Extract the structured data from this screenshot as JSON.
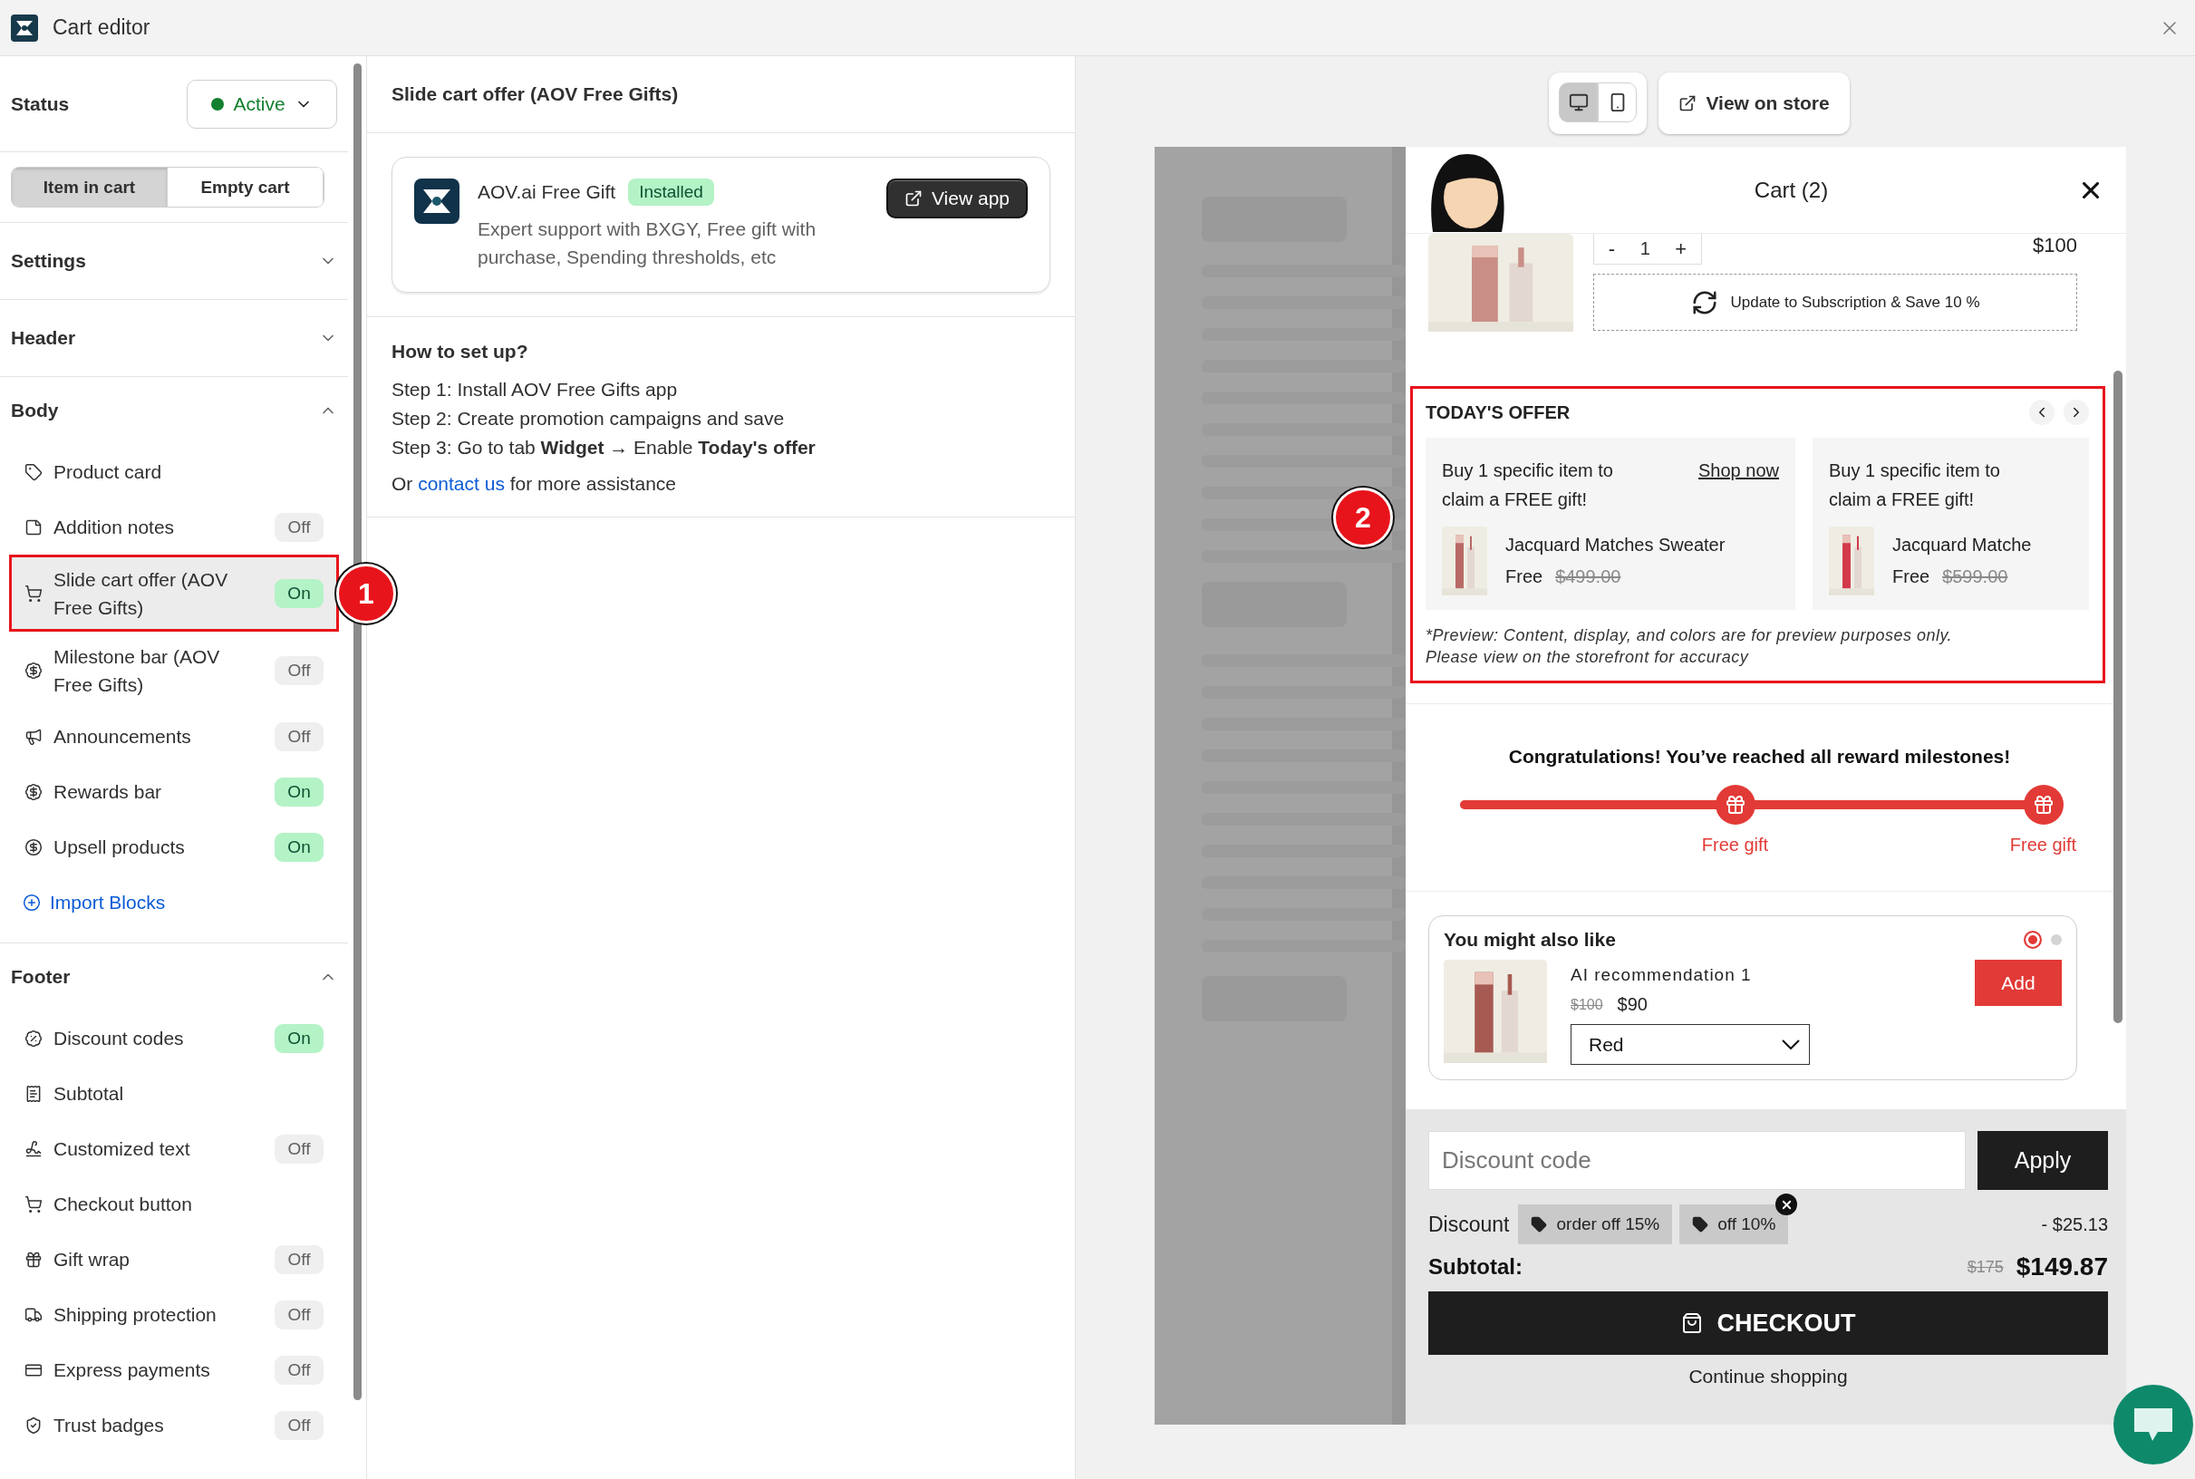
{
  "window": {
    "title": "Cart editor"
  },
  "sidebar": {
    "status_label": "Status",
    "status": "Active",
    "view_tabs": [
      {
        "label": "Item in cart",
        "selected": true
      },
      {
        "label": "Empty cart",
        "selected": false
      }
    ],
    "sections": [
      {
        "title": "Settings",
        "expanded": false
      },
      {
        "title": "Header",
        "expanded": false
      },
      {
        "title": "Body",
        "expanded": true,
        "action": "Import Blocks",
        "items": [
          {
            "label": "Product card",
            "selected": false
          },
          {
            "label": "Addition notes",
            "selected": false,
            "on": false,
            "toggle": "Off"
          },
          {
            "label": "Slide cart offer (AOV Free Gifts)",
            "selected": true,
            "on": true,
            "toggle": "On",
            "callout": "1"
          },
          {
            "label": "Milestone bar (AOV Free Gifts)",
            "selected": false,
            "on": false,
            "toggle": "Off"
          },
          {
            "label": "Announcements",
            "selected": false,
            "on": false,
            "toggle": "Off"
          },
          {
            "label": "Rewards bar",
            "selected": false,
            "on": true,
            "toggle": "On"
          },
          {
            "label": "Upsell products",
            "selected": false,
            "on": true,
            "toggle": "On"
          }
        ]
      },
      {
        "title": "Footer",
        "expanded": true,
        "items": [
          {
            "label": "Discount codes",
            "selected": false,
            "on": true,
            "toggle": "On"
          },
          {
            "label": "Subtotal",
            "selected": false
          },
          {
            "label": "Customized text",
            "selected": false,
            "on": false,
            "toggle": "Off"
          },
          {
            "label": "Checkout button",
            "selected": false
          },
          {
            "label": "Gift wrap",
            "selected": false,
            "on": false,
            "toggle": "Off"
          },
          {
            "label": "Shipping protection",
            "selected": false,
            "on": false,
            "toggle": "Off"
          },
          {
            "label": "Express payments",
            "selected": false,
            "on": false,
            "toggle": "Off"
          },
          {
            "label": "Trust badges",
            "selected": false,
            "on": false,
            "toggle": "Off"
          }
        ]
      }
    ]
  },
  "detail": {
    "title": "Slide cart offer (AOV Free Gifts)",
    "app_card": {
      "name": "AOV.ai Free Gift",
      "badge": "Installed",
      "description": "Expert support with BXGY, Free gift with purchase, Spending thresholds, etc",
      "button": "View app"
    },
    "setup": {
      "heading": "How to set up?",
      "steps": [
        "Step 1: Install AOV Free Gifts app",
        "Step 2: Create promotion campaigns and save",
        "Step 3: Go to tab **Widget** → Enable **Today's offer**"
      ],
      "help": {
        "before": "Or",
        "link": "contact us",
        "after": "for more assistance"
      }
    }
  },
  "preview": {
    "devices": [
      {
        "kind": "desktop",
        "selected": true
      },
      {
        "kind": "mobile",
        "selected": false
      }
    ],
    "view_on_store": "View on store",
    "cart": {
      "title": "Cart (2)",
      "item": {
        "minus": "-",
        "quantity": "1",
        "plus": "+",
        "price": "$100",
        "subscription": "Update to Subscription & Save 10 %"
      },
      "offer": {
        "title": "TODAY'S OFFER",
        "callout": "2",
        "cards": [
          {
            "headline": "Buy 1 specific item to claim a FREE gift!",
            "link": "Shop now",
            "product": "Jacquard Matches Sweater",
            "price": "Free",
            "old_price": "$499.00"
          },
          {
            "headline": "Buy 1 specific item to claim a FREE gift!",
            "product": "Jacquard Matche",
            "price": "Free",
            "old_price": "$599.00"
          }
        ],
        "note": [
          "*Preview: Content, display, and colors are for preview purposes only.",
          "Please view on the storefront for accuracy"
        ]
      },
      "milestones": {
        "message": "Congratulations! You’ve reached all reward milestones!",
        "level": 1,
        "points": [
          {
            "label": "Free gift"
          },
          {
            "label": "Free gift"
          }
        ]
      },
      "upsell": {
        "title": "You might also like",
        "pages": [
          {
            "selected": true
          },
          {
            "selected": false
          }
        ],
        "name": "AI recommendation 1",
        "old_price": "$100",
        "price": "$90",
        "variant": "Red",
        "button": "Add"
      },
      "footer": {
        "discount_placeholder": "Discount code",
        "apply": "Apply",
        "discount_label": "Discount",
        "codes": [
          {
            "label": "order off 15%",
            "removable": false
          },
          {
            "label": "off 10%",
            "removable": true
          }
        ],
        "discount_amount": "- $25.13",
        "subtotal_label": "Subtotal:",
        "old_total": "$175",
        "total": "$149.87",
        "checkout": "CHECKOUT",
        "continue": "Continue shopping"
      }
    }
  }
}
